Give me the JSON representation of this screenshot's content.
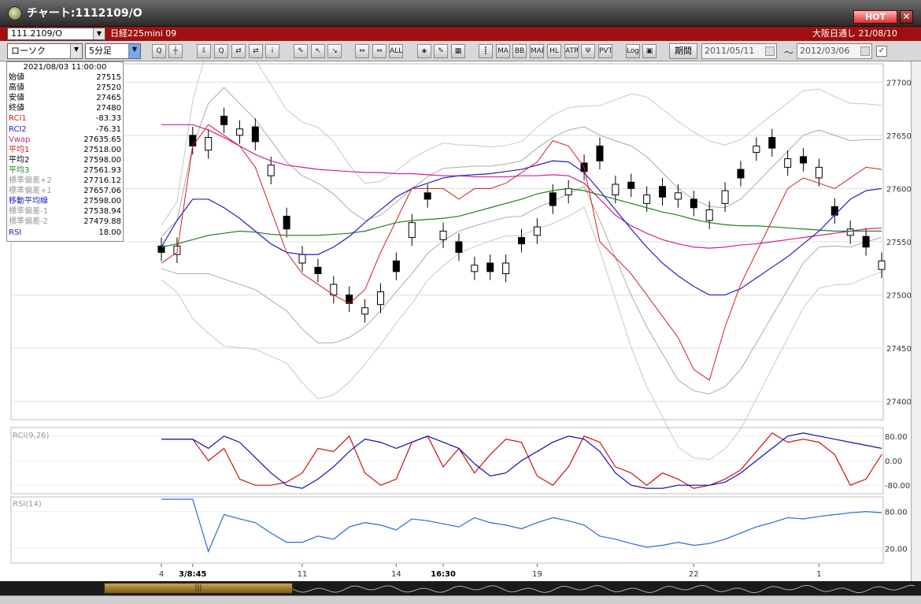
{
  "window": {
    "title": "チャート:1112109/O",
    "hot_label": "HOT",
    "close_glyph": "✕"
  },
  "symbol_bar": {
    "code": "111.2109/O",
    "instrument": "日経225mini 09",
    "session": "大阪日通し  21/08/10"
  },
  "toolbar": {
    "chart_type": "ローソク",
    "interval": "5分足",
    "tools": [
      "Q",
      "┼",
      "⇩",
      "Q",
      "⇄",
      "⇄",
      "i",
      "✎",
      "↖",
      "↘",
      "⇔",
      "⇔",
      "ALL",
      "◈",
      "✎",
      "▦",
      "┋",
      "MA",
      "BB",
      "MAE",
      "HL",
      "ATR",
      "Ψ",
      "PVT",
      "Log",
      "▣"
    ],
    "period_label": "期間",
    "date_from": "2011/05/11",
    "date_to": "2012/03/06",
    "tilde": "～",
    "check_glyph": "✓"
  },
  "info_panel": {
    "datetime": "2021/08/03  11:00:00",
    "rows": [
      {
        "label": "始値",
        "value": "27515",
        "color": "#000000"
      },
      {
        "label": "高値",
        "value": "27520",
        "color": "#000000"
      },
      {
        "label": "安値",
        "value": "27465",
        "color": "#000000"
      },
      {
        "label": "終値",
        "value": "27480",
        "color": "#000000"
      },
      {
        "label": "RCI1",
        "value": "-83.33",
        "color": "#d02020"
      },
      {
        "label": "RCI2",
        "value": "-76.31",
        "color": "#2020c0"
      },
      {
        "label": "Vwap",
        "value": "27635.65",
        "color": "#d0208a"
      },
      {
        "label": "平均1",
        "value": "27518.00",
        "color": "#d02020"
      },
      {
        "label": "平均2",
        "value": "27598.00",
        "color": "#000000"
      },
      {
        "label": "平均3",
        "value": "27561.93",
        "color": "#208020"
      },
      {
        "label": "標準偏差+2",
        "value": "27716.12",
        "color": "#999999"
      },
      {
        "label": "標準偏差+1",
        "value": "27657.06",
        "color": "#999999"
      },
      {
        "label": "移動平均線",
        "value": "27598.00",
        "color": "#2020c0"
      },
      {
        "label": "標準偏差-1",
        "value": "27538.94",
        "color": "#999999"
      },
      {
        "label": "標準偏差-2",
        "value": "27479.88",
        "color": "#999999"
      },
      {
        "label": "RSI",
        "value": "18.00",
        "color": "#2020c0"
      }
    ]
  },
  "indicator_labels": {
    "rci": "RCI(9,26)",
    "rsi": "RSI(14)"
  },
  "scrollbar": {
    "thumb_glyph": "|||"
  },
  "chart_data": [
    {
      "type": "candlestick",
      "ylim": [
        27385,
        27715
      ],
      "yticks": [
        27400,
        27450,
        27500,
        27550,
        27600,
        27650,
        27700
      ],
      "x_ticks": [
        {
          "label": "4",
          "index": 0
        },
        {
          "label": "3/8:45",
          "index": 2
        },
        {
          "label": "11",
          "index": 9
        },
        {
          "label": "14",
          "index": 15
        },
        {
          "label": "16:30",
          "index": 18
        },
        {
          "label": "19",
          "index": 24
        },
        {
          "label": "22",
          "index": 34
        },
        {
          "label": "1",
          "index": 42
        }
      ],
      "n_points": 47,
      "close": [
        27540,
        27546,
        27640,
        27648,
        27660,
        27656,
        27644,
        27622,
        27562,
        27538,
        27520,
        27510,
        27492,
        27488,
        27503,
        27522,
        27568,
        27590,
        27560,
        27540,
        27528,
        27522,
        27530,
        27548,
        27564,
        27584,
        27600,
        27616,
        27626,
        27604,
        27600,
        27594,
        27592,
        27596,
        27582,
        27580,
        27598,
        27610,
        27640,
        27638,
        27628,
        27624,
        27620,
        27575,
        27562,
        27545,
        27532
      ],
      "close_line": [
        27530,
        27540,
        27640,
        27660,
        27650,
        27640,
        27620,
        27580,
        27540,
        27520,
        27510,
        27500,
        27492,
        27505,
        27540,
        27570,
        27600,
        27600,
        27600,
        27590,
        27600,
        27600,
        27605,
        27615,
        27625,
        27645,
        27640,
        27620,
        27550,
        27535,
        27520,
        27500,
        27480,
        27460,
        27430,
        27420,
        27470,
        27510,
        27540,
        27570,
        27600,
        27610,
        27605,
        27600,
        27610,
        27620,
        27618
      ],
      "open_offsets": [
        6,
        -8,
        10,
        -12,
        8,
        -6,
        14,
        -10,
        12,
        -8,
        6,
        -10,
        8,
        -6,
        -12,
        10,
        -14,
        6,
        -8,
        10,
        -6,
        8,
        -10,
        6,
        -8,
        12,
        -6,
        8,
        14,
        -10,
        6,
        -8,
        10,
        -6,
        8,
        -10,
        -12,
        8,
        -6,
        10,
        -8,
        6,
        -10,
        8,
        -6,
        10,
        -8
      ],
      "bb_mid": [
        27540,
        27545,
        27580,
        27600,
        27605,
        27595,
        27585,
        27570,
        27555,
        27540,
        27530,
        27525,
        27520,
        27520,
        27530,
        27545,
        27560,
        27575,
        27585,
        27590,
        27593,
        27595,
        27598,
        27600,
        27610,
        27618,
        27625,
        27630,
        27610,
        27590,
        27570,
        27550,
        27530,
        27510,
        27500,
        27495,
        27498,
        27510,
        27530,
        27550,
        27570,
        27590,
        27600,
        27598,
        27595,
        27598,
        27600
      ],
      "bb_width": [
        15,
        25,
        60,
        80,
        90,
        85,
        80,
        75,
        70,
        72,
        75,
        70,
        60,
        50,
        45,
        42,
        40,
        36,
        34,
        30,
        28,
        26,
        25,
        26,
        28,
        30,
        30,
        28,
        40,
        55,
        70,
        80,
        85,
        90,
        90,
        88,
        84,
        80,
        75,
        70,
        65,
        60,
        55,
        52,
        50,
        48,
        46
      ],
      "vwap": [
        27660,
        27660,
        27660,
        27655,
        27648,
        27640,
        27632,
        27626,
        27622,
        27620,
        27618,
        27617,
        27616,
        27615,
        27615,
        27614,
        27614,
        27613,
        27612,
        27612,
        27611,
        27611,
        27611,
        27612,
        27612,
        27613,
        27612,
        27605,
        27590,
        27575,
        27565,
        27558,
        27552,
        27548,
        27545,
        27544,
        27545,
        27547,
        27548,
        27550,
        27552,
        27554,
        27556,
        27558,
        27560,
        27562,
        27563
      ],
      "ma3": [
        27545,
        27548,
        27552,
        27556,
        27558,
        27560,
        27559,
        27557,
        27556,
        27556,
        27556,
        27557,
        27558,
        27560,
        27564,
        27568,
        27570,
        27571,
        27572,
        27574,
        27578,
        27582,
        27586,
        27590,
        27595,
        27598,
        27600,
        27598,
        27594,
        27590,
        27586,
        27582,
        27578,
        27575,
        27571,
        27568,
        27566,
        27565,
        27565,
        27564,
        27563,
        27562,
        27561,
        27560,
        27560,
        27560,
        27560
      ],
      "ma_blue": [
        27545,
        27570,
        27590,
        27590,
        27582,
        27572,
        27560,
        27548,
        27540,
        27538,
        27538,
        27545,
        27555,
        27568,
        27580,
        27592,
        27600,
        27605,
        27610,
        27612,
        27613,
        27614,
        27616,
        27618,
        27622,
        27626,
        27625,
        27615,
        27598,
        27580,
        27562,
        27545,
        27530,
        27518,
        27508,
        27500,
        27500,
        27506,
        27516,
        27526,
        27536,
        27548,
        27560,
        27575,
        27590,
        27598,
        27600
      ]
    },
    {
      "type": "line",
      "ylim": [
        -100,
        100
      ],
      "yticks": [
        80,
        0,
        -80
      ],
      "series": [
        {
          "color": "#cc1010",
          "values": [
            70,
            70,
            70,
            0,
            40,
            -60,
            -80,
            -80,
            -70,
            -40,
            40,
            30,
            80,
            -40,
            -80,
            -60,
            60,
            80,
            -20,
            40,
            -40,
            20,
            70,
            60,
            -50,
            -80,
            -20,
            80,
            60,
            -20,
            -40,
            -80,
            -40,
            -60,
            -90,
            -80,
            -60,
            -30,
            30,
            90,
            60,
            70,
            60,
            20,
            -80,
            -60,
            20
          ]
        },
        {
          "color": "#1010b0",
          "values": [
            70,
            70,
            70,
            40,
            80,
            60,
            10,
            -40,
            -80,
            -90,
            -60,
            -20,
            30,
            70,
            60,
            40,
            60,
            80,
            60,
            40,
            -10,
            -50,
            -40,
            0,
            30,
            60,
            80,
            70,
            30,
            -40,
            -80,
            -90,
            -90,
            -80,
            -80,
            -80,
            -70,
            -40,
            0,
            40,
            80,
            90,
            80,
            70,
            60,
            50,
            40
          ]
        }
      ]
    },
    {
      "type": "line",
      "ylim": [
        0,
        100
      ],
      "yticks": [
        80,
        20
      ],
      "series": [
        {
          "color": "#2a6ad8",
          "values": [
            100,
            100,
            100,
            15,
            75,
            68,
            62,
            45,
            30,
            30,
            40,
            35,
            55,
            62,
            58,
            50,
            68,
            65,
            60,
            55,
            70,
            62,
            58,
            52,
            62,
            70,
            65,
            58,
            40,
            35,
            28,
            22,
            25,
            30,
            25,
            28,
            35,
            45,
            55,
            62,
            70,
            68,
            72,
            75,
            78,
            80,
            78
          ]
        }
      ]
    }
  ]
}
